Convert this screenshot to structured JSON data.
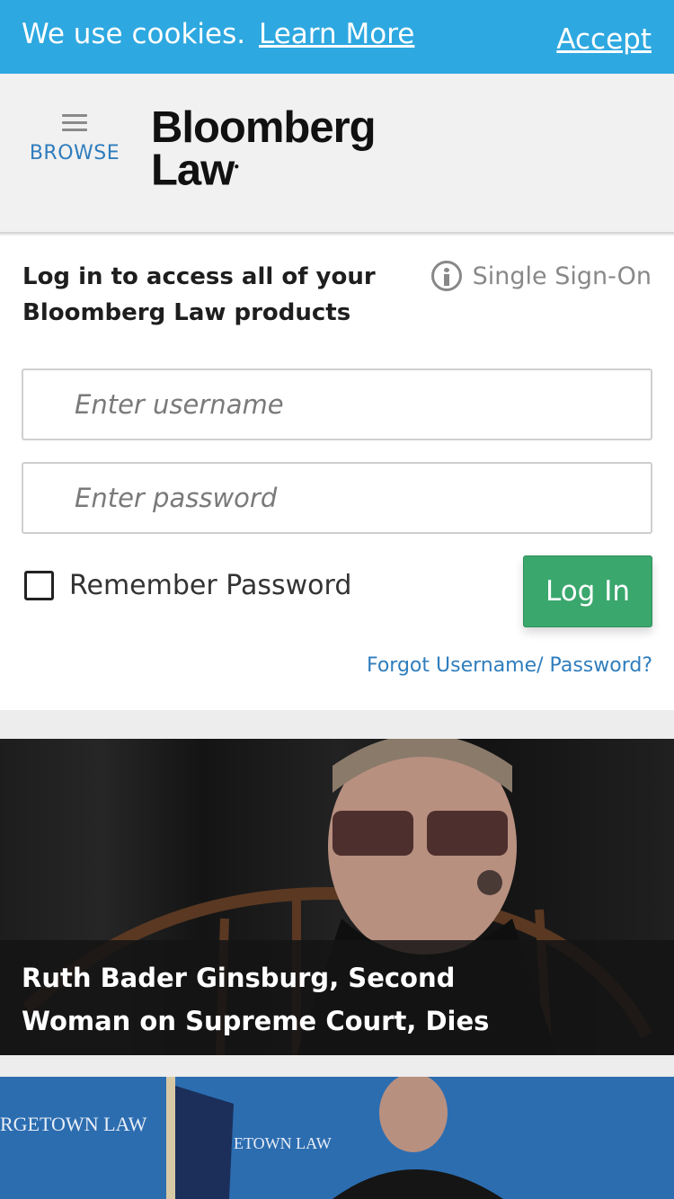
{
  "cookie": {
    "text": "We use cookies.",
    "learn_more": "Learn More",
    "accept": "Accept"
  },
  "header": {
    "browse_label": "BROWSE",
    "logo_line1": "Bloomberg",
    "logo_line2": "Law",
    "hamburger_icon": "hamburger-icon"
  },
  "login": {
    "title": "Log in to access all of your Bloomberg Law products",
    "sso_label": "Single Sign-On",
    "username_placeholder": "Enter username",
    "password_placeholder": "Enter password",
    "remember_label": "Remember Password",
    "login_button": "Log In",
    "forgot_link": "Forgot Username/ Password?"
  },
  "news": {
    "items": [
      {
        "title": "Ruth Bader Ginsburg, Second Woman on Supreme Court, Dies"
      }
    ],
    "image2_texts": [
      "RGETOWN LAW",
      "ETOWN LAW"
    ]
  },
  "colors": {
    "cookie_bar": "#2ea8e0",
    "link_blue": "#2f7dbd",
    "login_green": "#3aa76d"
  }
}
